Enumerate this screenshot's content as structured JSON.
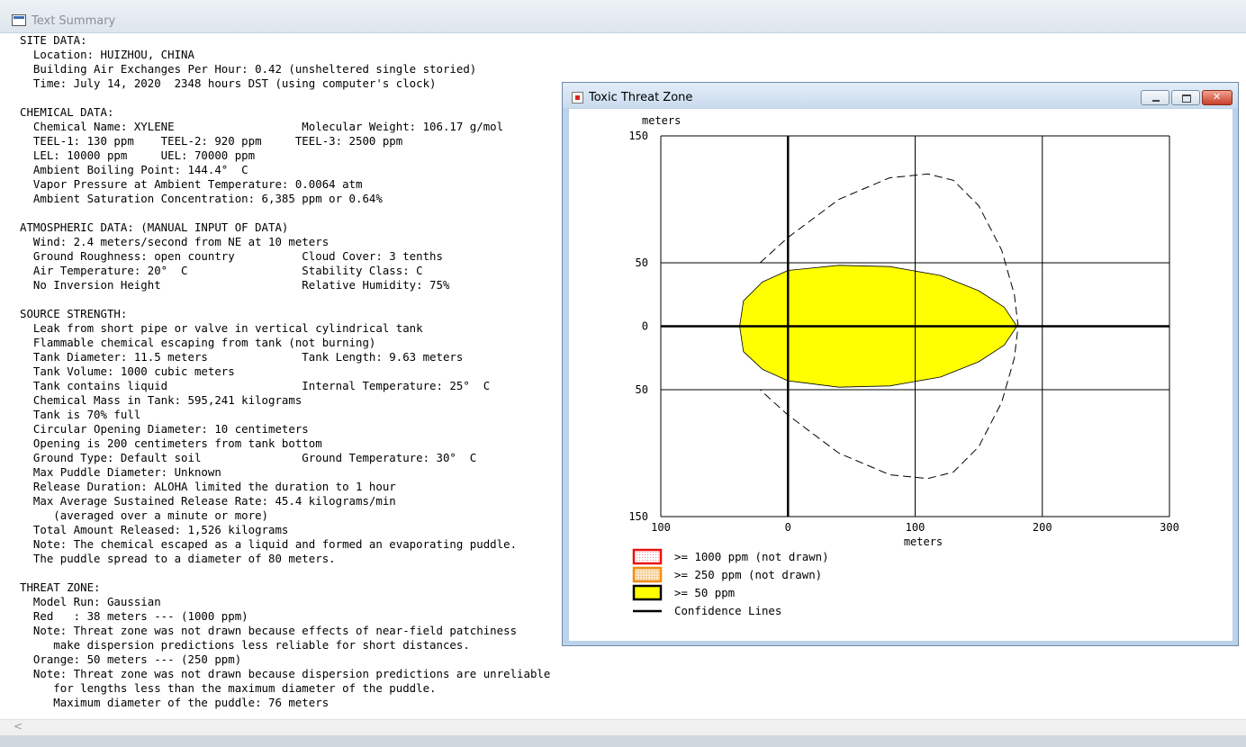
{
  "main_window": {
    "title": "Text Summary"
  },
  "summary_lines": [
    "SITE DATA:",
    "  Location: HUIZHOU, CHINA",
    "  Building Air Exchanges Per Hour: 0.42 (unsheltered single storied)",
    "  Time: July 14, 2020  2348 hours DST (using computer's clock)",
    "",
    "CHEMICAL DATA:",
    "  Chemical Name: XYLENE                   Molecular Weight: 106.17 g/mol",
    "  TEEL-1: 130 ppm    TEEL-2: 920 ppm     TEEL-3: 2500 ppm",
    "  LEL: 10000 ppm     UEL: 70000 ppm",
    "  Ambient Boiling Point: 144.4°  C",
    "  Vapor Pressure at Ambient Temperature: 0.0064 atm",
    "  Ambient Saturation Concentration: 6,385 ppm or 0.64%",
    "",
    "ATMOSPHERIC DATA: (MANUAL INPUT OF DATA)",
    "  Wind: 2.4 meters/second from NE at 10 meters",
    "  Ground Roughness: open country          Cloud Cover: 3 tenths",
    "  Air Temperature: 20°  C                 Stability Class: C",
    "  No Inversion Height                     Relative Humidity: 75%",
    "",
    "SOURCE STRENGTH:",
    "  Leak from short pipe or valve in vertical cylindrical tank",
    "  Flammable chemical escaping from tank (not burning)",
    "  Tank Diameter: 11.5 meters              Tank Length: 9.63 meters",
    "  Tank Volume: 1000 cubic meters",
    "  Tank contains liquid                    Internal Temperature: 25°  C",
    "  Chemical Mass in Tank: 595,241 kilograms",
    "  Tank is 70% full",
    "  Circular Opening Diameter: 10 centimeters",
    "  Opening is 200 centimeters from tank bottom",
    "  Ground Type: Default soil               Ground Temperature: 30°  C",
    "  Max Puddle Diameter: Unknown",
    "  Release Duration: ALOHA limited the duration to 1 hour",
    "  Max Average Sustained Release Rate: 45.4 kilograms/min",
    "     (averaged over a minute or more)",
    "  Total Amount Released: 1,526 kilograms",
    "  Note: The chemical escaped as a liquid and formed an evaporating puddle.",
    "  The puddle spread to a diameter of 80 meters.",
    "",
    "THREAT ZONE:",
    "  Model Run: Gaussian",
    "  Red   : 38 meters --- (1000 ppm)",
    "  Note: Threat zone was not drawn because effects of near-field patchiness",
    "     make dispersion predictions less reliable for short distances.",
    "  Orange: 50 meters --- (250 ppm)",
    "  Note: Threat zone was not drawn because dispersion predictions are unreliable",
    "     for lengths less than the maximum diameter of the puddle.",
    "     Maximum diameter of the puddle: 76 meters"
  ],
  "toxic_window": {
    "title": "Toxic Threat Zone"
  },
  "chart_data": {
    "type": "area",
    "title": "",
    "xlabel": "meters",
    "ylabel": "meters",
    "xlim": [
      -100,
      300
    ],
    "ylim": [
      -150,
      150
    ],
    "x_ticks": [
      -100,
      0,
      100,
      200,
      300
    ],
    "x_tick_labels": [
      "100",
      "0",
      "100",
      "200",
      "300"
    ],
    "y_ticks": [
      150,
      50,
      0,
      -50,
      -150
    ],
    "y_tick_labels": [
      "150",
      "50",
      "0",
      "50",
      "150"
    ],
    "grid": true,
    "threat_zone_50ppm": {
      "label": ">= 50 ppm",
      "color": "#ffff00",
      "outline": [
        [
          -38,
          0
        ],
        [
          -35,
          20
        ],
        [
          -20,
          35
        ],
        [
          0,
          44
        ],
        [
          40,
          48
        ],
        [
          80,
          47
        ],
        [
          120,
          40
        ],
        [
          150,
          28
        ],
        [
          170,
          15
        ],
        [
          180,
          0
        ],
        [
          170,
          -15
        ],
        [
          150,
          -28
        ],
        [
          120,
          -40
        ],
        [
          80,
          -47
        ],
        [
          40,
          -48
        ],
        [
          0,
          -43
        ],
        [
          -20,
          -34
        ],
        [
          -35,
          -20
        ],
        [
          -38,
          0
        ]
      ]
    },
    "confidence_lines": [
      [
        -22,
        50
      ],
      [
        0,
        70
      ],
      [
        40,
        100
      ],
      [
        80,
        117
      ],
      [
        110,
        120
      ],
      [
        130,
        115
      ],
      [
        150,
        95
      ],
      [
        168,
        60
      ],
      [
        178,
        25
      ],
      [
        181,
        0
      ],
      [
        178,
        -25
      ],
      [
        168,
        -60
      ],
      [
        150,
        -95
      ],
      [
        130,
        -115
      ],
      [
        110,
        -120
      ],
      [
        80,
        -117
      ],
      [
        40,
        -100
      ],
      [
        0,
        -70
      ],
      [
        -22,
        -50
      ]
    ],
    "legend": [
      {
        "label": ">= 1000 ppm (not drawn)",
        "fill": "#ffffff",
        "border": "#e81010",
        "pattern": "dots"
      },
      {
        "label": ">= 250 ppm (not drawn)",
        "fill": "#f5d3a0",
        "border": "#f08c10",
        "pattern": "dots"
      },
      {
        "label": ">= 50 ppm",
        "fill": "#ffff00",
        "border": "#000000",
        "pattern": "solid"
      },
      {
        "label": "Confidence Lines",
        "fill": "",
        "border": "#000000",
        "pattern": "line"
      }
    ]
  }
}
